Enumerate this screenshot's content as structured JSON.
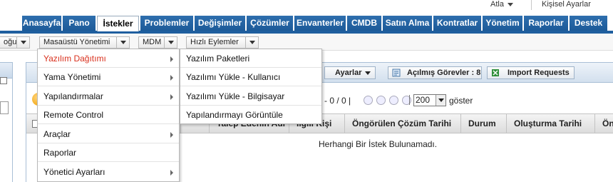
{
  "top": {
    "user_label": "Atla",
    "personal_settings": "Kişisel Ayarlar"
  },
  "nav": {
    "tabs": [
      {
        "label": "Anasayfa"
      },
      {
        "label": "Pano"
      },
      {
        "label": "İstekler"
      },
      {
        "label": "Problemler"
      },
      {
        "label": "Değişimler"
      },
      {
        "label": "Çözümler"
      },
      {
        "label": "Envanterler"
      },
      {
        "label": "CMDB"
      },
      {
        "label": "Satın Alma"
      },
      {
        "label": "Kontratlar"
      },
      {
        "label": "Yönetim"
      },
      {
        "label": "Raporlar"
      },
      {
        "label": "Destek"
      }
    ],
    "active_index": 2
  },
  "toolbar": {
    "partial_label": "oğu",
    "desktop_mgmt": "Masaüstü Yönetimi",
    "mdm": "MDM",
    "quick_actions": "Hızlı Eylemler"
  },
  "menu": {
    "items": [
      {
        "label": "Yazılım Dağıtımı",
        "has_submenu": true,
        "active": true
      },
      {
        "label": "Yama Yönetimi",
        "has_submenu": true
      },
      {
        "label": "Yapılandırmalar",
        "has_submenu": true
      },
      {
        "label": "Remote Control",
        "has_submenu": false
      },
      {
        "label": "Araçlar",
        "has_submenu": true
      },
      {
        "label": "Raporlar",
        "has_submenu": false
      },
      {
        "label": "Yönetici Ayarları",
        "has_submenu": true
      }
    ]
  },
  "submenu": {
    "items": [
      {
        "label": "Yazılım Paketleri"
      },
      {
        "label": "Yazılımı Yükle - Kullanıcı"
      },
      {
        "label": "Yazılımı Yükle - Bilgisayar"
      },
      {
        "label": "Yapılandırmayı Görüntüle"
      }
    ]
  },
  "main": {
    "settings_button": "Ayarlar",
    "open_tasks": "Açılmış Görevler : 8",
    "import_requests": "Import Requests",
    "pager_range": "- 0 / 0 |",
    "page_size": "200",
    "show_label": "göster",
    "columns": [
      {
        "label": ""
      },
      {
        "label": ""
      },
      {
        "label": "Talep Edenin Adı"
      },
      {
        "label": "İlgili Kişi"
      },
      {
        "label": "Öngörülen Çözüm Tarihi"
      },
      {
        "label": "Durum"
      },
      {
        "label": "Oluşturma Tarihi"
      },
      {
        "label": "Ön"
      }
    ],
    "empty_message": "Herhangi Bir İstek Bulunamadı."
  }
}
